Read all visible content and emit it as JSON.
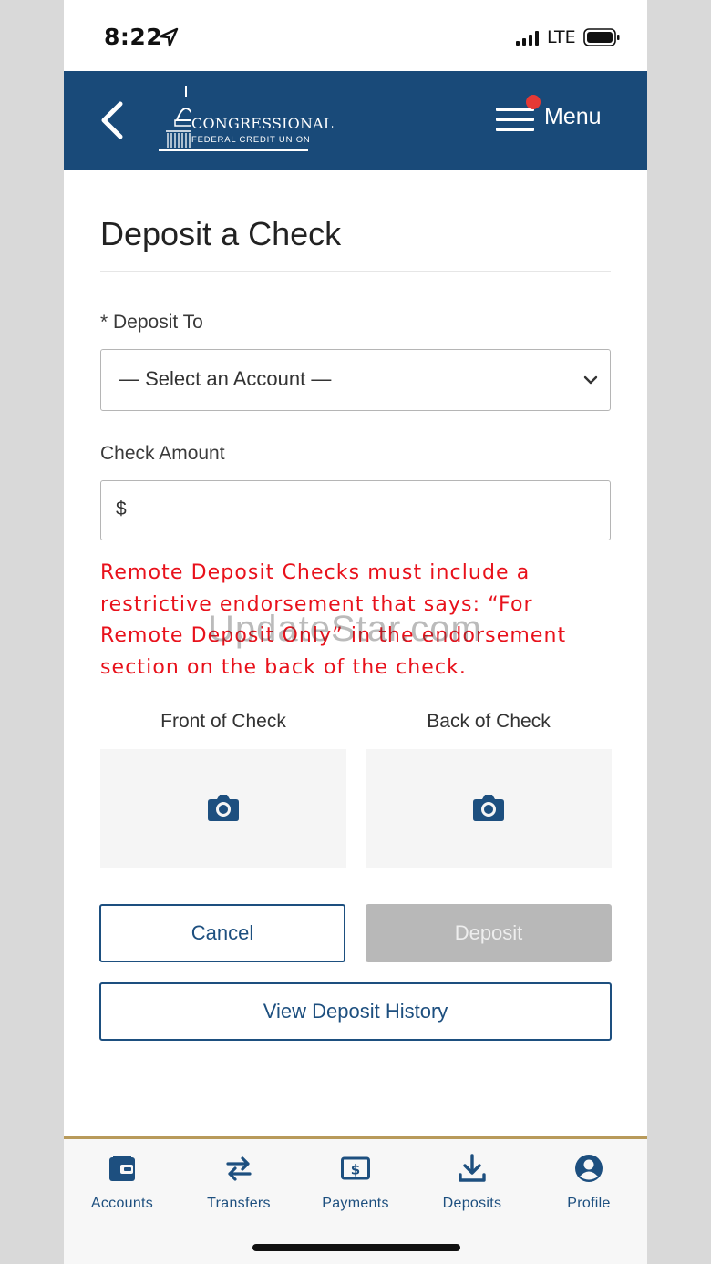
{
  "status_bar": {
    "time": "8:22",
    "carrier": "LTE"
  },
  "header": {
    "logo_line1": "CONGRESSIONAL",
    "logo_line2": "FEDERAL CREDIT UNION",
    "menu_label": "Menu",
    "brand_color": "#194a79",
    "notification_color": "#e53935"
  },
  "page": {
    "title": "Deposit a Check",
    "deposit_to_label": "* Deposit To",
    "deposit_to_value": "— Select an Account —",
    "check_amount_label": "Check Amount",
    "currency_symbol": "$",
    "check_amount_value": "",
    "warning_lines": [
      "Remote Deposit Checks must include a",
      "restrictive endorsement that says: “For",
      "Remote Deposit Only” in the endorsement",
      "section on the back of the check."
    ],
    "warning_color": "#e8111b",
    "watermark": "UpdateStar.com",
    "front_label": "Front of Check",
    "back_label": "Back of Check",
    "cancel_label": "Cancel",
    "deposit_label": "Deposit",
    "history_label": "View Deposit History"
  },
  "bottom_nav": {
    "items": [
      {
        "label": "Accounts",
        "icon": "wallet-icon"
      },
      {
        "label": "Transfers",
        "icon": "transfer-arrows-icon"
      },
      {
        "label": "Payments",
        "icon": "dollar-bill-icon"
      },
      {
        "label": "Deposits",
        "icon": "download-icon"
      },
      {
        "label": "Profile",
        "icon": "user-circle-icon"
      }
    ]
  }
}
